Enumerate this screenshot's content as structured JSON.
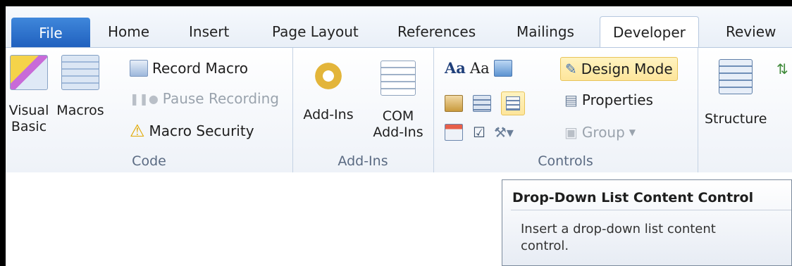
{
  "tabs": [
    {
      "label": "File"
    },
    {
      "label": "Home"
    },
    {
      "label": "Insert"
    },
    {
      "label": "Page Layout"
    },
    {
      "label": "References"
    },
    {
      "label": "Mailings"
    },
    {
      "label": "Developer"
    },
    {
      "label": "Review"
    }
  ],
  "groups": {
    "code": {
      "label": "Code",
      "visual_basic_line1": "Visual",
      "visual_basic_line2": "Basic",
      "macros": "Macros",
      "record_macro": "Record Macro",
      "pause_recording": "Pause Recording",
      "macro_security": "Macro Security"
    },
    "addins": {
      "label": "Add-Ins",
      "addins_button": "Add-Ins",
      "com_line1": "COM",
      "com_line2": "Add-Ins"
    },
    "controls": {
      "label": "Controls",
      "aa_rich": "Aa",
      "aa_plain": "Aa",
      "design_mode": "Design Mode",
      "properties": "Properties",
      "group": "Group"
    },
    "structure": {
      "structure_button": "Structure"
    }
  },
  "tooltip": {
    "title": "Drop-Down List Content Control",
    "body": "Insert a drop-down list content control."
  },
  "colors": {
    "file_tab": "#2a6fcb",
    "highlight": "#fde59b"
  }
}
